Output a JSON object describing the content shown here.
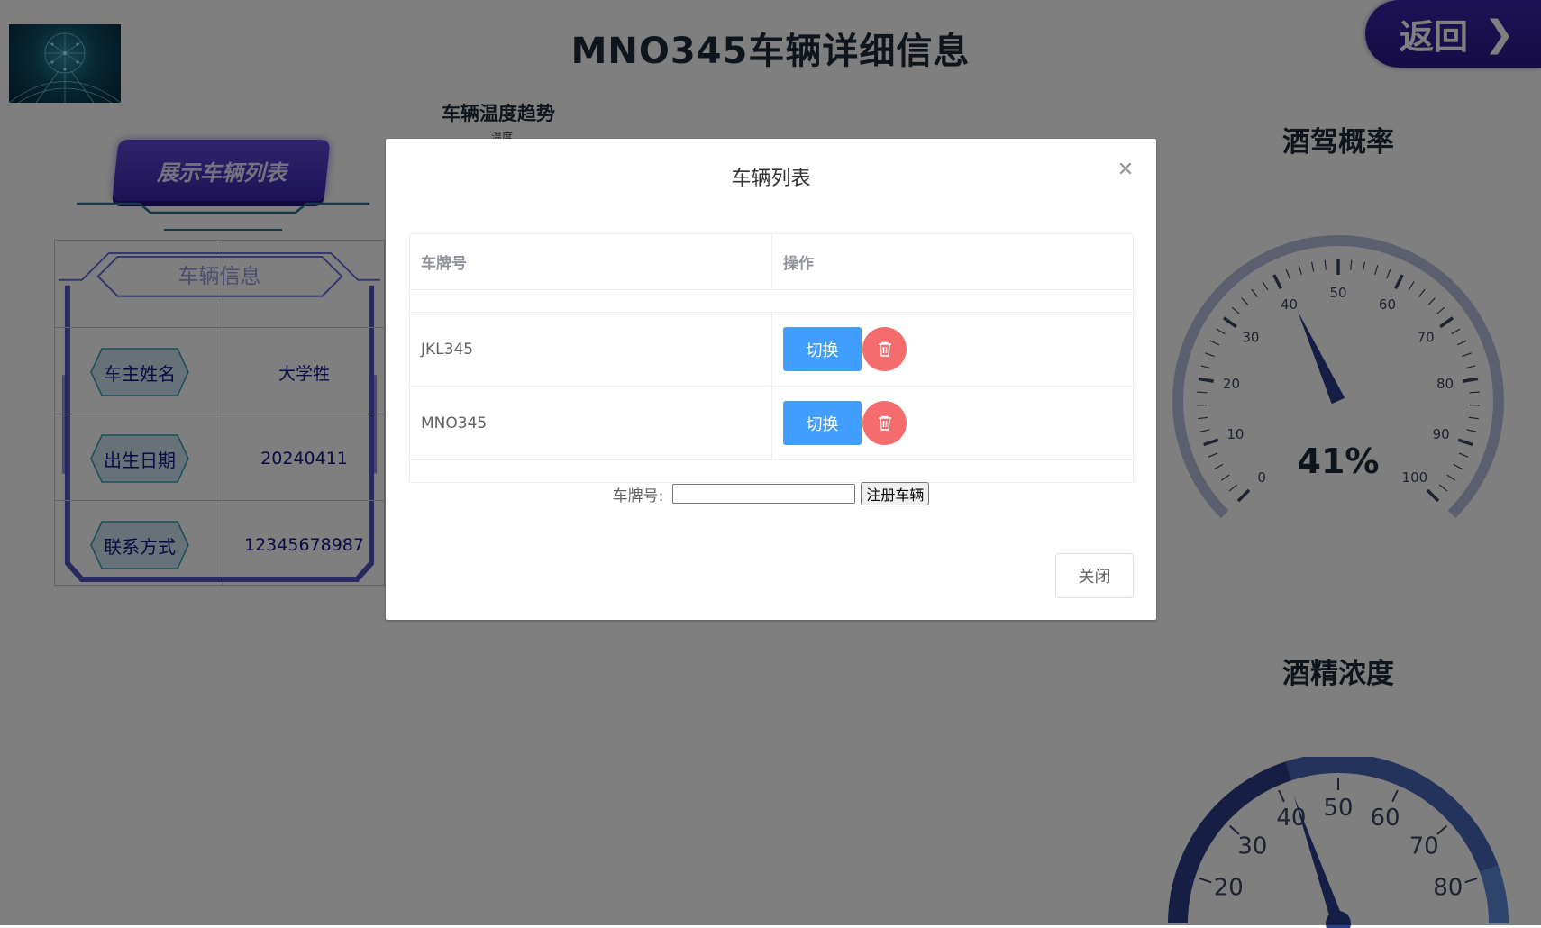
{
  "header": {
    "title": "MNO345车辆详细信息",
    "back_label": "返回"
  },
  "temperature": {
    "title": "车辆温度趋势",
    "ylabel": "温度"
  },
  "show_list_button": "展示车辆列表",
  "vehicle_info": {
    "title": "车辆信息",
    "rows": [
      {
        "label": "车主姓名",
        "value": "大学牲"
      },
      {
        "label": "出生日期",
        "value": "20240411"
      },
      {
        "label": "联系方式",
        "value": "12345678987"
      }
    ]
  },
  "drunk_probability": {
    "title": "酒驾概率",
    "value": 41,
    "display": "41%",
    "ticks": [
      "0",
      "10",
      "20",
      "30",
      "40",
      "50",
      "60",
      "70",
      "80",
      "90",
      "100"
    ],
    "range": [
      0,
      100
    ]
  },
  "alcohol_concentration": {
    "title": "酒精浓度",
    "ticks": [
      "20",
      "30",
      "40",
      "50",
      "60",
      "70",
      "80"
    ],
    "needle_value": 42
  },
  "modal": {
    "title": "车辆列表",
    "columns": [
      "车牌号",
      "操作"
    ],
    "rows": [
      {
        "plate": "JKL345",
        "switch_label": "切换"
      },
      {
        "plate": "MNO345",
        "switch_label": "切换"
      }
    ],
    "register_label": "车牌号:",
    "register_input_value": "",
    "register_button": "注册车辆",
    "close_button": "关闭"
  },
  "colors": {
    "primary": "#409eff",
    "danger": "#f56c6c",
    "brand_purple": "#3b24a8",
    "gauge_track": "#b8c1dc",
    "gauge_needle": "#2a3f8c"
  }
}
